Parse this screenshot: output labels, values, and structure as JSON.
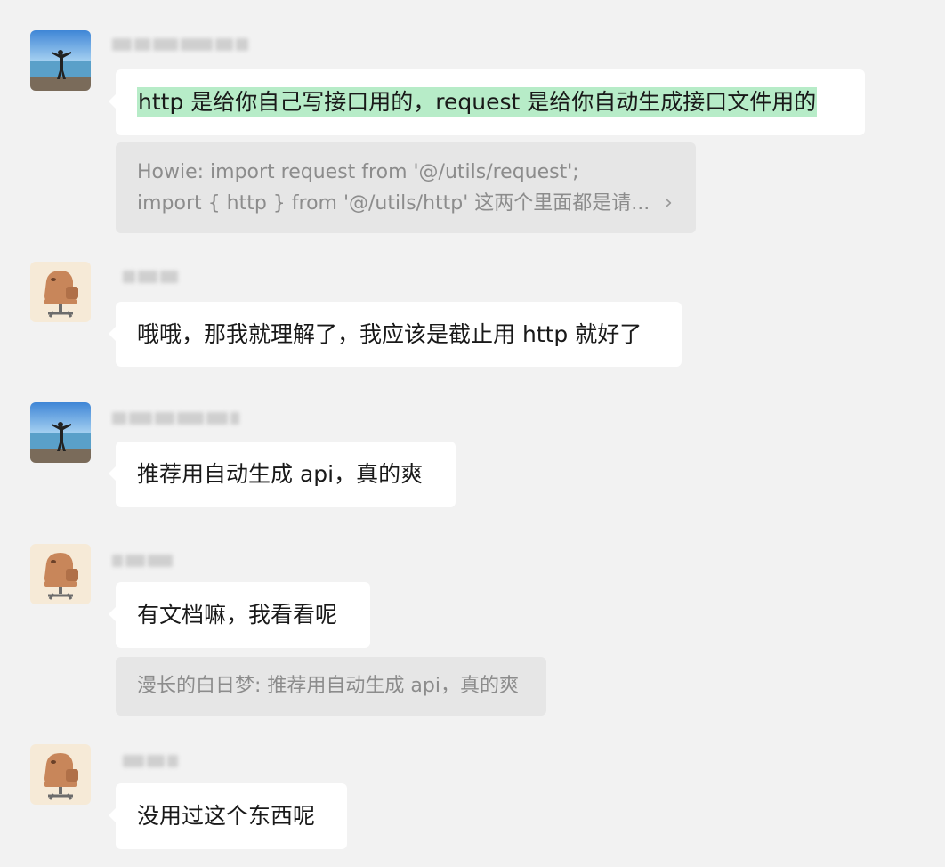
{
  "messages": [
    {
      "avatar": "photo-avatar",
      "name_placeholder": "漫长的白日梦",
      "text": "http 是给你自己写接口用的，request 是给你自动生成接口文件用的",
      "highlighted": true,
      "quote": {
        "line1": "Howie: import request from '@/utils/request';",
        "line2": "import { http } from '@/utils/http' 这两个里面都是请...",
        "chevron": "›"
      }
    },
    {
      "avatar": "capybara-chair-avatar",
      "name_placeholder": "Howie",
      "text": "哦哦，那我就理解了，我应该是截止用 http 就好了"
    },
    {
      "avatar": "photo-avatar",
      "name_placeholder": "漫长的白日梦",
      "text": "推荐用自动生成 api，真的爽"
    },
    {
      "avatar": "capybara-chair-avatar",
      "name_placeholder": "Howie",
      "text": "有文档嘛，我看看呢",
      "quote": {
        "line1": "漫长的白日梦: 推荐用自动生成 api，真的爽"
      }
    },
    {
      "avatar": "capybara-chair-avatar",
      "name_placeholder": "Howie",
      "text": "没用过这个东西呢"
    }
  ],
  "colors": {
    "background": "#f2f2f2",
    "bubble": "#ffffff",
    "highlight": "#b7ecc8",
    "quote_bg": "#e6e6e6",
    "quote_text": "#8c8c8c"
  }
}
